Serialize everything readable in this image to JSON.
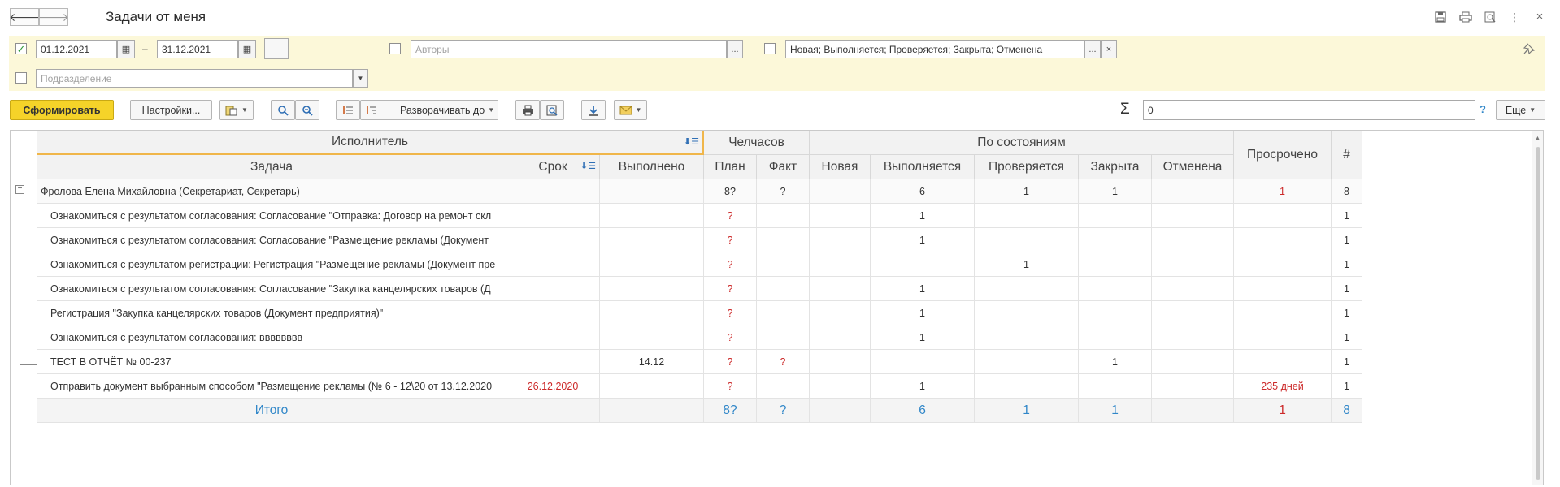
{
  "window": {
    "title": "Задачи от меня"
  },
  "filters": {
    "period_checked": true,
    "date_from": "01.12.2021",
    "date_sep": "–",
    "date_to": "31.12.2021",
    "authors_checked": false,
    "authors_placeholder": "Авторы",
    "states_checked": false,
    "states_value": "Новая; Выполняется; Проверяется; Закрыта; Отменена",
    "dept_checked": false,
    "dept_placeholder": "Подразделение",
    "ellipsis": "...",
    "clear": "×"
  },
  "toolbar": {
    "generate": "Сформировать",
    "settings": "Настройки...",
    "expand_to": "Разворачивать до",
    "sigma": "Σ",
    "sum_value": "0",
    "help": "?",
    "more": "Еще"
  },
  "report": {
    "headers": {
      "executor": "Исполнитель",
      "task": "Задача",
      "deadline": "Срок",
      "done": "Выполнено",
      "manhours": "Челчасов",
      "plan": "План",
      "fact": "Факт",
      "by_states": "По состояниям",
      "new": "Новая",
      "in_progress": "Выполняется",
      "checking": "Проверяется",
      "closed": "Закрыта",
      "cancelled": "Отменена",
      "overdue": "Просрочено",
      "count": "#"
    },
    "group": {
      "name": "Фролова Елена Михайловна (Секретариат, Секретарь)",
      "plan": "8?",
      "fact": "?",
      "new": "",
      "in_progress": "6",
      "checking": "1",
      "closed": "1",
      "cancelled": "",
      "overdue": "1",
      "count": "8"
    },
    "rows": [
      {
        "task": "Ознакомиться с результатом согласования: Согласование \"Отправка: Договор на ремонт скл",
        "deadline": "",
        "done": "",
        "plan": "?",
        "fact": "",
        "new": "",
        "in_progress": "1",
        "checking": "",
        "closed": "",
        "cancelled": "",
        "overdue": "",
        "count": "1"
      },
      {
        "task": "Ознакомиться с результатом согласования: Согласование \"Размещение рекламы (Документ",
        "deadline": "",
        "done": "",
        "plan": "?",
        "fact": "",
        "new": "",
        "in_progress": "1",
        "checking": "",
        "closed": "",
        "cancelled": "",
        "overdue": "",
        "count": "1"
      },
      {
        "task": "Ознакомиться с результатом регистрации: Регистрация \"Размещение рекламы (Документ пре",
        "deadline": "",
        "done": "",
        "plan": "?",
        "fact": "",
        "new": "",
        "in_progress": "",
        "checking": "1",
        "closed": "",
        "cancelled": "",
        "overdue": "",
        "count": "1"
      },
      {
        "task": "Ознакомиться с результатом согласования: Согласование \"Закупка канцелярских товаров (Д",
        "deadline": "",
        "done": "",
        "plan": "?",
        "fact": "",
        "new": "",
        "in_progress": "1",
        "checking": "",
        "closed": "",
        "cancelled": "",
        "overdue": "",
        "count": "1"
      },
      {
        "task": "Регистрация \"Закупка канцелярских товаров (Документ предприятия)\"",
        "deadline": "",
        "done": "",
        "plan": "?",
        "fact": "",
        "new": "",
        "in_progress": "1",
        "checking": "",
        "closed": "",
        "cancelled": "",
        "overdue": "",
        "count": "1"
      },
      {
        "task": "Ознакомиться с результатом согласования: вввввввв",
        "deadline": "",
        "done": "",
        "plan": "?",
        "fact": "",
        "new": "",
        "in_progress": "1",
        "checking": "",
        "closed": "",
        "cancelled": "",
        "overdue": "",
        "count": "1"
      },
      {
        "task": "ТЕСТ В ОТЧЁТ № 00-237",
        "deadline": "",
        "done": "14.12",
        "plan": "?",
        "fact": "?",
        "new": "",
        "in_progress": "",
        "checking": "",
        "closed": "1",
        "cancelled": "",
        "overdue": "",
        "count": "1"
      },
      {
        "task": "Отправить документ выбранным способом \"Размещение рекламы (№ 6 - 12\\20 от 13.12.2020",
        "deadline": "26.12.2020",
        "done": "",
        "plan": "?",
        "fact": "",
        "new": "",
        "in_progress": "1",
        "checking": "",
        "closed": "",
        "cancelled": "",
        "overdue": "235 дней",
        "count": "1"
      }
    ],
    "total": {
      "label": "Итого",
      "plan": "8?",
      "fact": "?",
      "new": "",
      "in_progress": "6",
      "checking": "1",
      "closed": "1",
      "cancelled": "",
      "overdue": "1",
      "count": "8"
    }
  },
  "colors": {
    "filter_bg": "#fcf8d9",
    "primary_button": "#f5d329",
    "overdue_red": "#cc2a2a",
    "total_blue": "#2f86c8",
    "checkbox_green": "#2e9a39"
  }
}
